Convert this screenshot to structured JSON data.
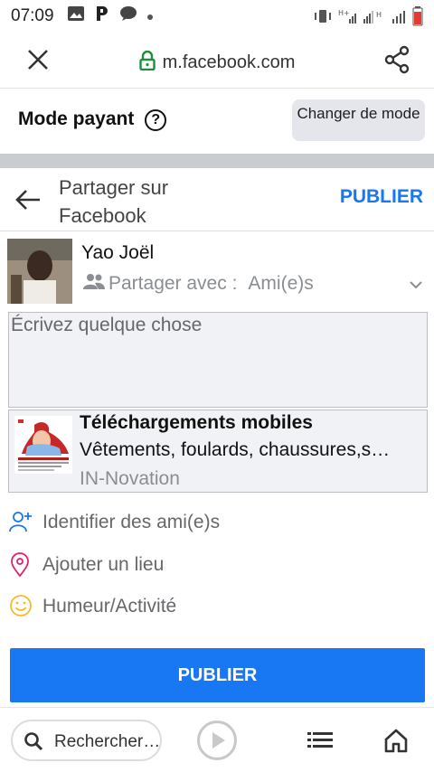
{
  "status_bar": {
    "time": "07:09",
    "icons": [
      "image-icon",
      "p-app-icon",
      "chat-bubble-icon",
      "dot-icon"
    ],
    "right_icons": [
      "vibrate-icon",
      "h-plus-signal-icon",
      "h-signal-icon",
      "battery-icon"
    ]
  },
  "browser": {
    "url": "m.facebook.com",
    "close_icon": "close-icon",
    "secure_icon": "lock-icon",
    "share_icon": "share-icon"
  },
  "mode": {
    "title": "Mode payant",
    "help_symbol": "?",
    "change_button": "Changer de mode"
  },
  "share_header": {
    "title": "Partager sur Facebook",
    "publish_link": "PUBLIER"
  },
  "user": {
    "name": "Yao Joël",
    "audience_label": "Partager avec :",
    "audience_value": "Ami(e)s"
  },
  "composer": {
    "placeholder": "Écrivez quelque chose"
  },
  "link_preview": {
    "title": "Téléchargements mobiles",
    "description": "Vêtements, foulards, chaussures,s…",
    "source": "IN-Novation"
  },
  "actions": [
    {
      "label": "Identifier des ami(e)s",
      "icon": "tag-friends-icon",
      "color": "#1877f2"
    },
    {
      "label": "Ajouter un lieu",
      "icon": "location-pin-icon",
      "color": "#e41e6f"
    },
    {
      "label": "Humeur/Activité",
      "icon": "smiley-icon",
      "color": "#f7b928"
    }
  ],
  "publish_button": "PUBLIER",
  "bottom_bar": {
    "search_text": "Rechercher…",
    "icons": [
      "search-icon",
      "play-icon",
      "list-icon",
      "home-icon"
    ]
  },
  "colors": {
    "accent": "#1877f2",
    "separator": "#c9ccd1",
    "muted_text": "#8a8d91"
  }
}
